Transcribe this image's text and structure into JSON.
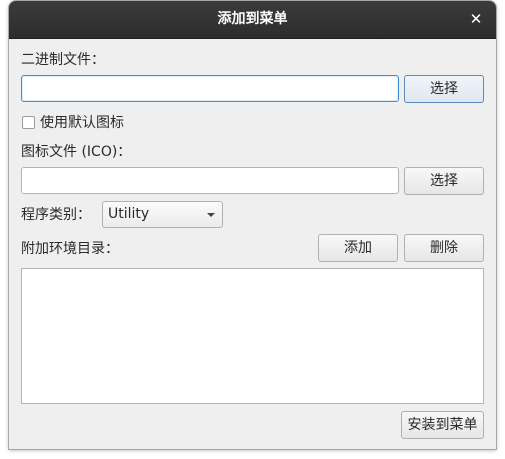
{
  "dialog": {
    "title": "添加到菜单",
    "close_glyph": "✕"
  },
  "binary": {
    "label": "二进制文件：",
    "value": "",
    "browse_label": "选择"
  },
  "default_icon": {
    "label": "使用默认图标",
    "checked": false
  },
  "icon_file": {
    "label": "图标文件 (ICO)：",
    "value": "",
    "browse_label": "选择"
  },
  "category": {
    "label": "程序类别：",
    "selected": "Utility"
  },
  "env_dirs": {
    "label": "附加环境目录：",
    "add_label": "添加",
    "remove_label": "删除",
    "items": []
  },
  "footer": {
    "install_label": "安装到菜单"
  }
}
